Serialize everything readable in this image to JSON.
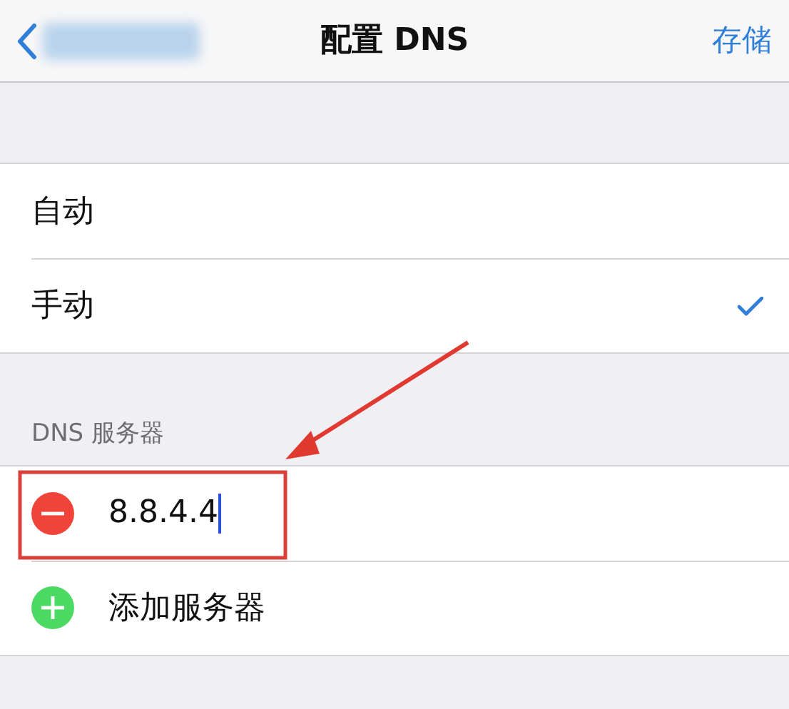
{
  "nav": {
    "title": "配置 DNS",
    "action": "存储"
  },
  "modes": [
    {
      "label": "自动",
      "selected": false
    },
    {
      "label": "手动",
      "selected": true
    }
  ],
  "dns_section": {
    "header": "DNS 服务器",
    "rows": [
      {
        "kind": "remove",
        "text": "8.8.4.4",
        "editing": true
      },
      {
        "kind": "add",
        "text": "添加服务器",
        "editing": false
      }
    ]
  }
}
